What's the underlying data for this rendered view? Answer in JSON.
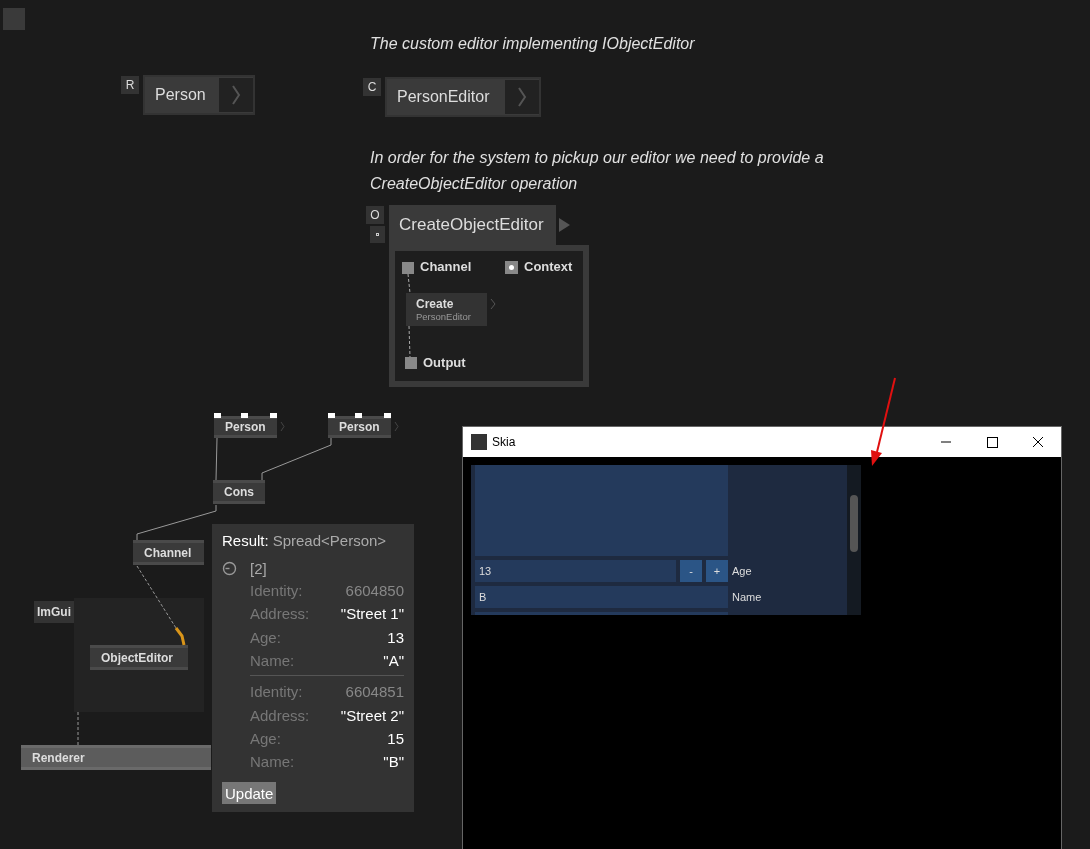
{
  "comments": [
    {
      "text": "The custom editor implementing IObjectEditor"
    },
    {
      "text": "In order for the system to pickup our editor we need to provide a CreateObjectEditor operation"
    }
  ],
  "definitions": [
    {
      "tag": "R",
      "name": "Person"
    },
    {
      "tag": "C",
      "name": "PersonEditor"
    }
  ],
  "operation": {
    "tag": "O",
    "name": "CreateObjectEditor",
    "inputs": [
      {
        "kind": "square",
        "label": "Channel"
      },
      {
        "kind": "radio",
        "label": "Context"
      }
    ],
    "inner_node": {
      "name": "Create",
      "subtitle": "PersonEditor"
    },
    "output": "Output"
  },
  "patch": {
    "nodes": [
      "Person",
      "Person",
      "Cons",
      "Channel",
      "ObjectEditor",
      "Renderer"
    ],
    "region_label": "ImGui"
  },
  "tooltip": {
    "label": "Result:",
    "type": "Spread<Person>",
    "count": "[2]",
    "records": [
      [
        {
          "label": "Identity:",
          "value": "6604850",
          "kind": "identity"
        },
        {
          "label": "Address:",
          "value": "\"Street 1\"",
          "kind": "value"
        },
        {
          "label": "Age:",
          "value": "13",
          "kind": "value"
        },
        {
          "label": "Name:",
          "value": "\"A\"",
          "kind": "value"
        }
      ],
      [
        {
          "label": "Identity:",
          "value": "6604851",
          "kind": "identity"
        },
        {
          "label": "Address:",
          "value": "\"Street 2\"",
          "kind": "value"
        },
        {
          "label": "Age:",
          "value": "15",
          "kind": "value"
        },
        {
          "label": "Name:",
          "value": "\"B\"",
          "kind": "value"
        }
      ]
    ],
    "button": "Update"
  },
  "skia_window": {
    "title": "Skia",
    "rows": [
      {
        "kind": "number",
        "value": "13",
        "decrement": "-",
        "increment": "+",
        "label": "Age"
      },
      {
        "kind": "text",
        "value": "B",
        "label": "Name"
      }
    ]
  }
}
